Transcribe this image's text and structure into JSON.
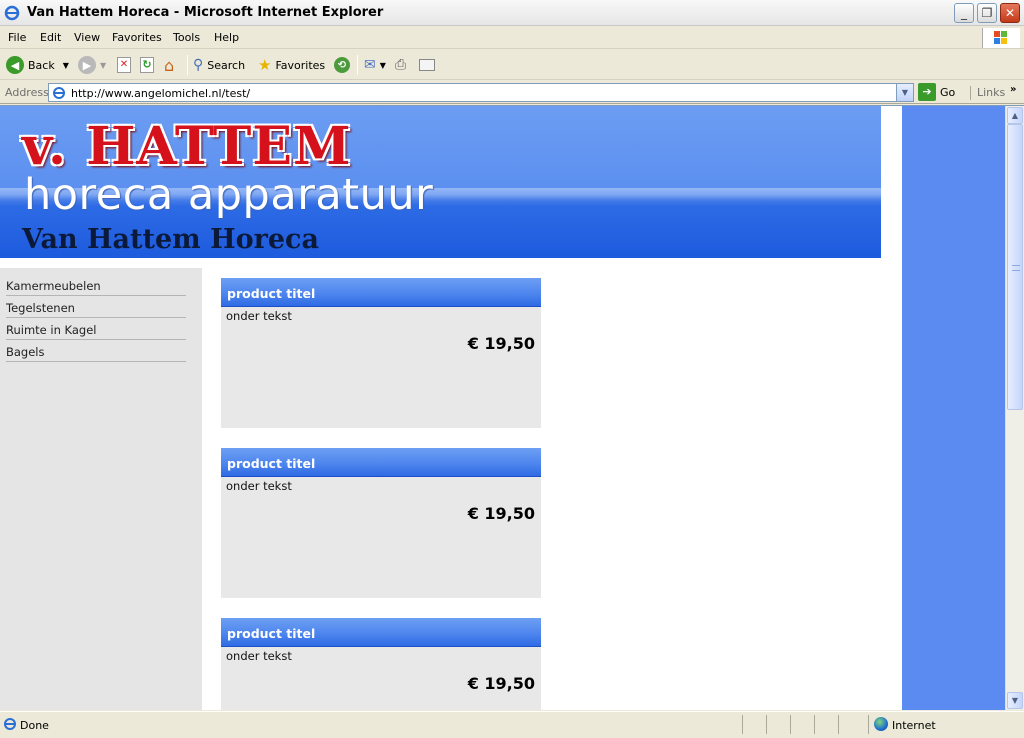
{
  "window": {
    "title": "Van Hattem Horeca - Microsoft Internet Explorer"
  },
  "menu": [
    "File",
    "Edit",
    "View",
    "Favorites",
    "Tools",
    "Help"
  ],
  "toolbar": {
    "back": "Back",
    "search": "Search",
    "favorites": "Favorites"
  },
  "address": {
    "label": "Address",
    "url": "http://www.angelomichel.nl/test/",
    "go": "Go",
    "links": "Links"
  },
  "header": {
    "logo_top": "v. HATTEM",
    "logo_bottom": "horeca apparatuur",
    "site_title": "Van Hattem Horeca"
  },
  "nav": [
    "Kamermeubelen",
    "Tegelstenen",
    "Ruimte in Kagel",
    "Bagels"
  ],
  "products": [
    {
      "title": "product titel",
      "text": "onder tekst",
      "price": "€ 19,50"
    },
    {
      "title": "product titel",
      "text": "onder tekst",
      "price": "€ 19,50"
    },
    {
      "title": "product titel",
      "text": "onder tekst",
      "price": "€ 19,50"
    }
  ],
  "status": {
    "text": "Done",
    "zone": "Internet"
  },
  "colors": {
    "accent_blue": "#5b8bf0",
    "logo_red": "#d5121c"
  }
}
